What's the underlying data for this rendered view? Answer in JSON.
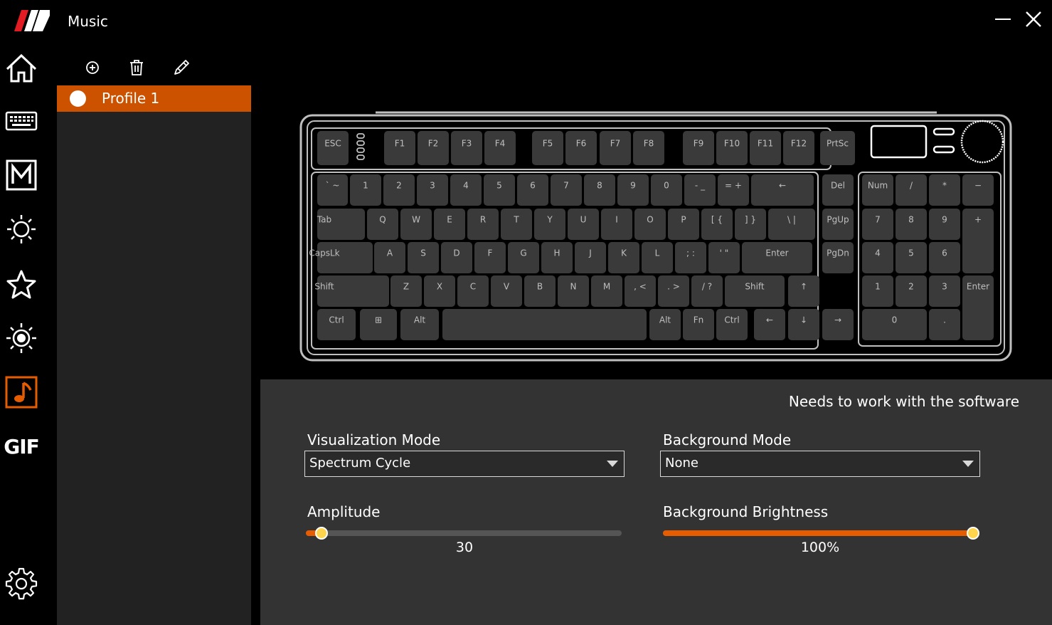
{
  "app": {
    "title": "Music"
  },
  "nav": {
    "items": [
      {
        "icon": "home-icon"
      },
      {
        "icon": "keyboard-icon"
      },
      {
        "icon": "macro-icon",
        "letter": "M"
      },
      {
        "icon": "lighting-icon"
      },
      {
        "icon": "star-icon"
      },
      {
        "icon": "brightness-icon"
      },
      {
        "icon": "music-icon",
        "active": true
      },
      {
        "icon": "gif-icon",
        "label": "GIF"
      },
      {
        "icon": "settings-icon"
      }
    ]
  },
  "profiles": {
    "toolbar": [
      "add-icon",
      "trash-icon",
      "edit-icon"
    ],
    "items": [
      {
        "label": "Profile 1",
        "selected": true
      }
    ]
  },
  "keyboard": {
    "rows": [
      [
        "ESC",
        "F1",
        "F2",
        "F3",
        "F4",
        "F5",
        "F6",
        "F7",
        "F8",
        "F9",
        "F10",
        "F11",
        "F12",
        "PrtSc"
      ],
      [
        "` ~",
        "1",
        "2",
        "3",
        "4",
        "5",
        "6",
        "7",
        "8",
        "9",
        "0",
        "- _",
        "= +",
        "←",
        "Del",
        "Num",
        "/",
        "*",
        "−"
      ],
      [
        "Tab",
        "Q",
        "W",
        "E",
        "R",
        "T",
        "Y",
        "U",
        "I",
        "O",
        "P",
        "[ {",
        "] }",
        "\\ |",
        "PgUp",
        "7",
        "8",
        "9",
        "+"
      ],
      [
        "CapsLk",
        "A",
        "S",
        "D",
        "F",
        "G",
        "H",
        "J",
        "K",
        "L",
        "; :",
        "' \"",
        "Enter",
        "PgDn",
        "4",
        "5",
        "6"
      ],
      [
        "Shift",
        "Z",
        "X",
        "C",
        "V",
        "B",
        "N",
        "M",
        ", <",
        ". >",
        "/ ?",
        "Shift",
        "↑",
        "1",
        "2",
        "3",
        "Enter"
      ],
      [
        "Ctrl",
        "⊞",
        "Alt",
        "",
        "Alt",
        "Fn",
        "Ctrl",
        "←",
        "↓",
        "→",
        "0",
        "."
      ]
    ]
  },
  "settings": {
    "hint": "Needs to work with the software",
    "visualization_mode": {
      "label": "Visualization Mode",
      "value": "Spectrum Cycle"
    },
    "background_mode": {
      "label": "Background Mode",
      "value": "None"
    },
    "amplitude": {
      "label": "Amplitude",
      "value": "30",
      "fraction": 0.05
    },
    "background_brightness": {
      "label": "Background Brightness",
      "value": "100%",
      "fraction": 1.0
    }
  },
  "colors": {
    "accent": "#cc5200",
    "slider_fill": "#e65c00",
    "thumb": "#ffd54d",
    "panel": "#333333",
    "sidebar": "#222222"
  }
}
